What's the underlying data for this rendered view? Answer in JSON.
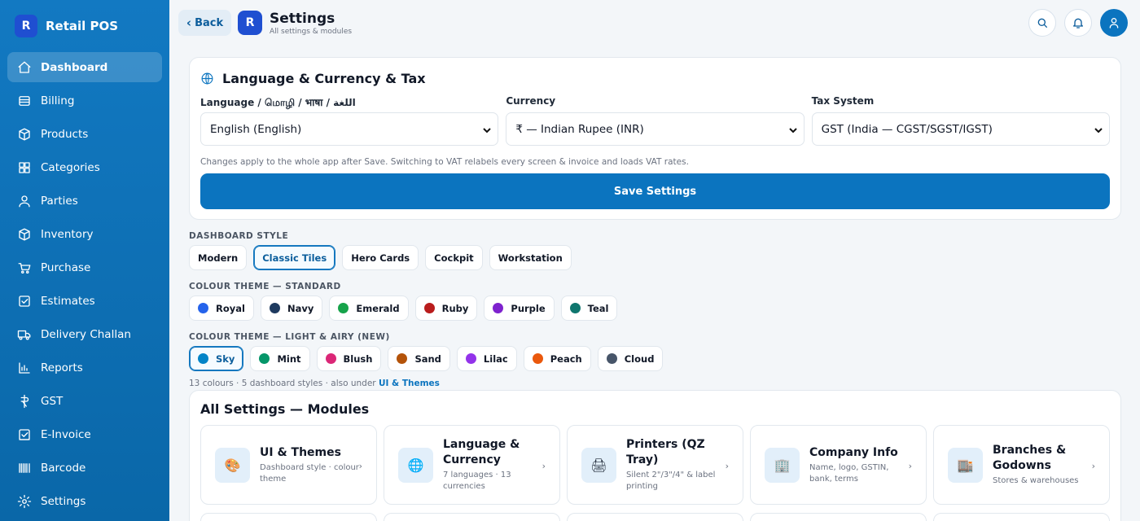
{
  "app": {
    "logo_letter": "R",
    "name": "Retail POS"
  },
  "sidebar": {
    "items": [
      {
        "label": "Dashboard",
        "icon": "home-icon",
        "active": true
      },
      {
        "label": "Billing",
        "icon": "receipt-icon"
      },
      {
        "label": "Products",
        "icon": "box-icon"
      },
      {
        "label": "Categories",
        "icon": "grid-icon"
      },
      {
        "label": "Parties",
        "icon": "user-icon"
      },
      {
        "label": "Inventory",
        "icon": "cube-icon"
      },
      {
        "label": "Purchase",
        "icon": "cart-icon"
      },
      {
        "label": "Estimates",
        "icon": "checkbox-icon"
      },
      {
        "label": "Delivery Challan",
        "icon": "truck-icon"
      },
      {
        "label": "Reports",
        "icon": "bar-chart-icon"
      },
      {
        "label": "GST",
        "icon": "rupee-icon"
      },
      {
        "label": "E-Invoice",
        "icon": "invoice-icon"
      },
      {
        "label": "Barcode",
        "icon": "barcode-icon"
      },
      {
        "label": "Settings",
        "icon": "gear-icon"
      }
    ]
  },
  "topbar": {
    "back_label": "Back",
    "page_logo_letter": "R",
    "title": "Settings",
    "subtitle": "All settings & modules"
  },
  "language_card": {
    "title": "Language & Currency & Tax",
    "language": {
      "label": "Language / மொழி / भाषा / اللغة",
      "value": "English (English)"
    },
    "currency": {
      "label": "Currency",
      "value": "₹ — Indian Rupee (INR)"
    },
    "tax": {
      "label": "Tax System",
      "value": "GST (India — CGST/SGST/IGST)"
    },
    "hint": "Changes apply to the whole app after Save. Switching to VAT relabels every screen & invoice and loads VAT rates.",
    "save_label": "Save Settings"
  },
  "dashboard_style": {
    "label": "DASHBOARD STYLE",
    "options": [
      "Modern",
      "Classic Tiles",
      "Hero Cards",
      "Cockpit",
      "Workstation"
    ],
    "selected": "Classic Tiles"
  },
  "theme_standard": {
    "label": "COLOUR THEME — STANDARD",
    "options": [
      {
        "name": "Royal",
        "color": "#2563eb"
      },
      {
        "name": "Navy",
        "color": "#1e3a5f"
      },
      {
        "name": "Emerald",
        "color": "#16a34a"
      },
      {
        "name": "Ruby",
        "color": "#b91c1c"
      },
      {
        "name": "Purple",
        "color": "#7e22ce"
      },
      {
        "name": "Teal",
        "color": "#0f766e"
      }
    ]
  },
  "theme_light": {
    "label": "COLOUR THEME — LIGHT & AIRY (NEW)",
    "options": [
      {
        "name": "Sky",
        "color": "#0284c7",
        "selected": true
      },
      {
        "name": "Mint",
        "color": "#059669"
      },
      {
        "name": "Blush",
        "color": "#db2777"
      },
      {
        "name": "Sand",
        "color": "#b45309"
      },
      {
        "name": "Lilac",
        "color": "#9333ea"
      },
      {
        "name": "Peach",
        "color": "#ea580c"
      },
      {
        "name": "Cloud",
        "color": "#475569"
      }
    ]
  },
  "theme_note": {
    "text": "13 colours · 5 dashboard styles · also under ",
    "link": "UI & Themes"
  },
  "modules": {
    "title": "All Settings — Modules",
    "tiles": [
      {
        "title": "UI & Themes",
        "desc": "Dashboard style · colour theme",
        "icon": "🎨"
      },
      {
        "title": "Language & Currency",
        "desc": "7 languages · 13 currencies",
        "icon": "🌐"
      },
      {
        "title": "Printers (QZ Tray)",
        "desc": "Silent 2\"/3\"/4\" & label printing",
        "icon": "🖨"
      },
      {
        "title": "Company Info",
        "desc": "Name, logo, GSTIN, bank, terms",
        "icon": "🏢"
      },
      {
        "title": "Branches & Godowns",
        "desc": "Stores & warehouses",
        "icon": "🏬"
      }
    ]
  }
}
